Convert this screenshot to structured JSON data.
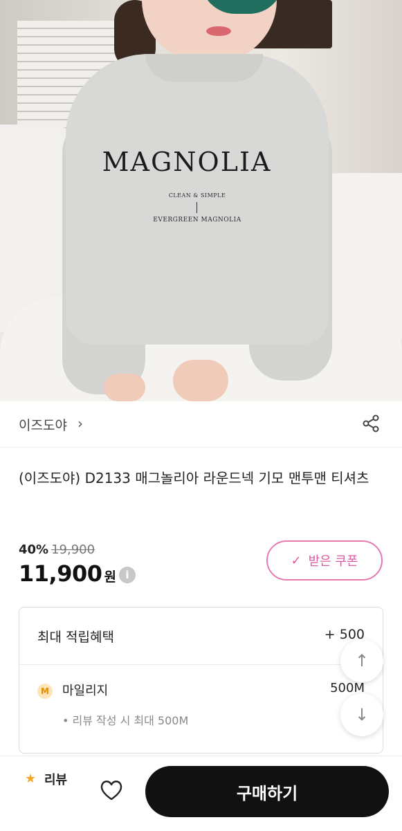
{
  "product_image": {
    "print_main": "MAGNOLIA",
    "print_tagline": "CLEAN & SIMPLE",
    "print_sub": "EVERGREEN MAGNOLIA"
  },
  "shop": {
    "name": "이즈도야",
    "chevron": "›",
    "share_icon": "share-icon"
  },
  "product": {
    "title": "(이즈도야) D2133 매그놀리아 라운드넥 기모 맨투맨 티셔츠"
  },
  "pricing": {
    "discount": "40%",
    "original_price": "19,900",
    "price": "11,900",
    "currency": "원",
    "info_icon": "i"
  },
  "coupon": {
    "check": "✓",
    "label": "받은 쿠폰"
  },
  "benefit": {
    "title": "최대 적립혜택",
    "total": "+ 500",
    "mileage_badge": "M",
    "mileage_label": "마일리지",
    "mileage_amount": "500M",
    "mileage_note": "• 리뷰 작성 시 최대 500M"
  },
  "scroll": {
    "up": "↑",
    "down": "↓"
  },
  "bottom_bar": {
    "review_star": "★",
    "review_label": "리뷰",
    "buy_label": "구매하기"
  },
  "colors": {
    "accent_pink": "#dd5aa1",
    "buy_button": "#111111",
    "star": "#f5a623"
  }
}
